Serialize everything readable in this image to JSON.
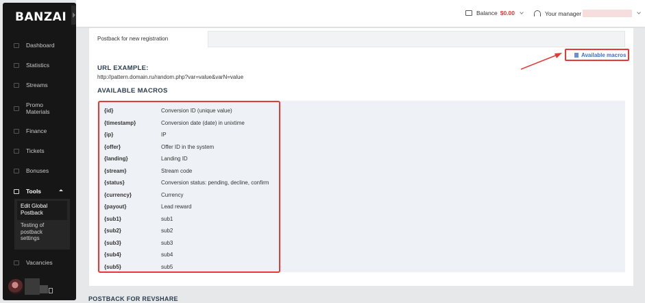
{
  "app": {
    "logo": "BANZAI"
  },
  "sidebar": {
    "items": [
      {
        "label": "Dashboard",
        "icon": "dashboard-icon"
      },
      {
        "label": "Statistics",
        "icon": "chart-icon"
      },
      {
        "label": "Streams",
        "icon": "streams-icon"
      },
      {
        "label": "Promo\nMaterials",
        "icon": "promo-icon"
      },
      {
        "label": "Finance",
        "icon": "finance-icon"
      },
      {
        "label": "Tickets",
        "icon": "tickets-icon"
      },
      {
        "label": "Bonuses",
        "icon": "bonuses-icon"
      },
      {
        "label": "Tools",
        "icon": "tools-icon"
      },
      {
        "label": "Vacancies",
        "icon": "vacancies-icon"
      }
    ],
    "tools_submenu": [
      {
        "label": "Edit Global\nPostback"
      },
      {
        "label": "Testing of\npostback\nsettings"
      }
    ]
  },
  "header": {
    "balance_label": "Balance",
    "balance_value": "$0.00",
    "manager_label": "Your manager"
  },
  "main": {
    "tab_label": "Postback for new registration",
    "macros_link": "Available macros",
    "url_example_title": "URL EXAMPLE:",
    "url_example": "http://pattern.domain.ru/random.php?var=value&varN=value",
    "macros_title": "AVAILABLE MACROS",
    "macros": [
      {
        "key": "{id}",
        "desc": "Conversion ID (unique value)"
      },
      {
        "key": "{timestamp}",
        "desc": "Conversion date (date) in unixtime"
      },
      {
        "key": "{ip}",
        "desc": "IP"
      },
      {
        "key": "{offer}",
        "desc": "Offer ID in the system"
      },
      {
        "key": "{landing}",
        "desc": "Landing ID"
      },
      {
        "key": "{stream}",
        "desc": "Stream code"
      },
      {
        "key": "{status}",
        "desc": "Conversion status: pending, decline, confirm"
      },
      {
        "key": "{currency}",
        "desc": "Currency"
      },
      {
        "key": "{payout}",
        "desc": "Lead reward"
      },
      {
        "key": "{sub1}",
        "desc": "sub1"
      },
      {
        "key": "{sub2}",
        "desc": "sub2"
      },
      {
        "key": "{sub3}",
        "desc": "sub3"
      },
      {
        "key": "{sub4}",
        "desc": "sub4"
      },
      {
        "key": "{sub5}",
        "desc": "sub5"
      }
    ],
    "revshare_title": "POSTBACK FOR REVSHARE"
  },
  "colors": {
    "accent_red": "#e53935",
    "link_blue": "#3a6fd8",
    "sidebar_bg": "#161616"
  }
}
